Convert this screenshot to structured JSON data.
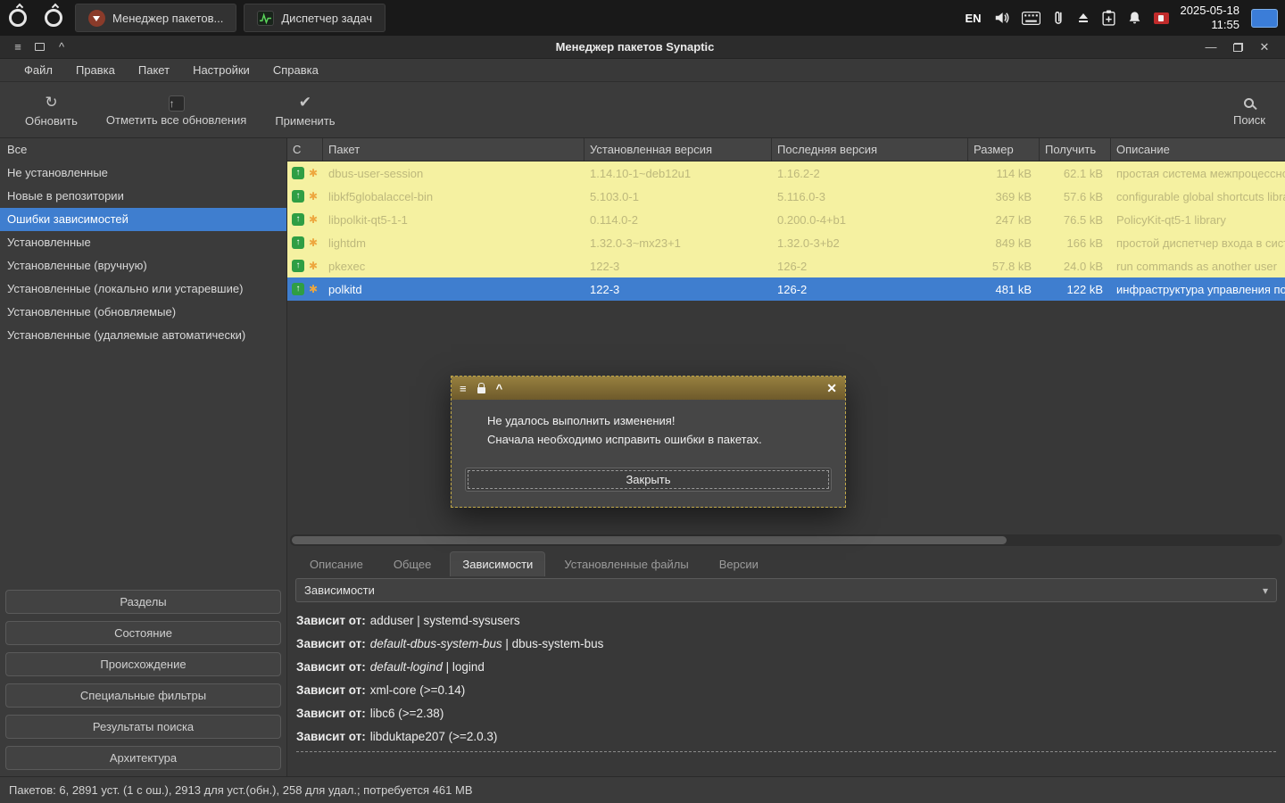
{
  "colors": {
    "selection-blue": "#3f7ecf",
    "broken-yellow": "#f5f1a1",
    "broken-row-text": "#bdb87c",
    "upgrade-green": "#2f9e44",
    "star-orange": "#eda73f",
    "dialog-title-top": "#97803f",
    "dialog-title-bottom": "#6e5a2b",
    "dialog-dashed-border": "#c2a949",
    "show-desktop-blue": "#3b7dd8"
  },
  "icons": {
    "hamburger": "≡",
    "shade": "^",
    "minimize": "—",
    "close": "✕",
    "refresh": "↻",
    "mark_upgrades": "↑",
    "apply": "✔",
    "chevron_down": "▾",
    "upgrade_arrow": "↑",
    "broken_star": "✱"
  },
  "taskbar": {
    "tasks": [
      {
        "label": "Менеджер пакетов..."
      },
      {
        "label": "Диспетчер задач"
      }
    ],
    "tray": {
      "language": "EN",
      "date": "2025-05-18",
      "time": "11:55"
    }
  },
  "window": {
    "title": "Менеджер пакетов Synaptic",
    "menus": [
      {
        "label": "Файл"
      },
      {
        "label": "Правка"
      },
      {
        "label": "Пакет"
      },
      {
        "label": "Настройки"
      },
      {
        "label": "Справка"
      }
    ],
    "toolbar": {
      "refresh_label": "Обновить",
      "mark_all_label": "Отметить все обновления",
      "apply_label": "Применить",
      "search_label": "Поиск"
    }
  },
  "sidebar": {
    "items": [
      {
        "label": "Все"
      },
      {
        "label": "Не установленные"
      },
      {
        "label": "Новые в репозитории"
      },
      {
        "label": "Ошибки зависимостей"
      },
      {
        "label": "Установленные"
      },
      {
        "label": "Установленные (вручную)"
      },
      {
        "label": "Установленные (локально или устаревшие)"
      },
      {
        "label": "Установленные (обновляемые)"
      },
      {
        "label": "Установленные (удаляемые автоматически)"
      }
    ],
    "selected_item": "Ошибки зависимостей",
    "filter_buttons": [
      {
        "label": "Разделы"
      },
      {
        "label": "Состояние"
      },
      {
        "label": "Происхождение"
      },
      {
        "label": "Специальные фильтры"
      },
      {
        "label": "Результаты поиска"
      },
      {
        "label": "Архитектура"
      }
    ]
  },
  "package_table": {
    "headers": {
      "status": "С",
      "package": "Пакет",
      "installed": "Установленная версия",
      "latest": "Последняя версия",
      "size": "Размер",
      "download": "Получить",
      "description": "Описание"
    },
    "rows": [
      {
        "package": "dbus-user-session",
        "installed_version": "1.14.10-1~deb12u1",
        "latest_version": "1.16.2-2",
        "size": "114 kB",
        "download": "62.1 kB",
        "description": "простая система межпроцессного взаимодействия"
      },
      {
        "package": "libkf5globalaccel-bin",
        "installed_version": "5.103.0-1",
        "latest_version": "5.116.0-3",
        "size": "369 kB",
        "download": "57.6 kB",
        "description": "configurable global shortcuts library"
      },
      {
        "package": "libpolkit-qt5-1-1",
        "installed_version": "0.114.0-2",
        "latest_version": "0.200.0-4+b1",
        "size": "247 kB",
        "download": "76.5 kB",
        "description": "PolicyKit-qt5-1 library"
      },
      {
        "package": "lightdm",
        "installed_version": "1.32.0-3~mx23+1",
        "latest_version": "1.32.0-3+b2",
        "size": "849 kB",
        "download": "166 kB",
        "description": "простой диспетчер входа в систему"
      },
      {
        "package": "pkexec",
        "installed_version": "122-3",
        "latest_version": "126-2",
        "size": "57.8 kB",
        "download": "24.0 kB",
        "description": "run commands as another user"
      },
      {
        "package": "polkitd",
        "installed_version": "122-3",
        "latest_version": "126-2",
        "size": "481 kB",
        "download": "122 kB",
        "description": "инфраструктура управления политиками"
      }
    ],
    "selected_package": "polkitd"
  },
  "dialog": {
    "message_line1": "Не удалось выполнить изменения!",
    "message_line2": "Сначала необходимо исправить ошибки в пакетах.",
    "close_label": "Закрыть"
  },
  "details": {
    "tabs": [
      {
        "label": "Описание"
      },
      {
        "label": "Общее"
      },
      {
        "label": "Зависимости"
      },
      {
        "label": "Установленные файлы"
      },
      {
        "label": "Версии"
      }
    ],
    "active_tab": "Зависимости",
    "combo_value": "Зависимости",
    "dependencies": [
      {
        "prefix": "Зависит от:",
        "italic": "",
        "rest": "adduser | systemd-sysusers"
      },
      {
        "prefix": "Зависит от:",
        "italic": "default-dbus-system-bus",
        "rest": " | dbus-system-bus"
      },
      {
        "prefix": "Зависит от:",
        "italic": "default-logind",
        "rest": " | logind"
      },
      {
        "prefix": "Зависит от:",
        "italic": "",
        "rest": "xml-core (>=0.14)"
      },
      {
        "prefix": "Зависит от:",
        "italic": "",
        "rest": "libc6 (>=2.38)"
      },
      {
        "prefix": "Зависит от:",
        "italic": "",
        "rest": "libduktape207 (>=2.0.3)"
      }
    ]
  },
  "statusbar": {
    "text": "Пакетов: 6, 2891 уст. (1 с ош.), 2913 для уст.(обн.), 258 для удал.; потребуется 461 MB"
  }
}
